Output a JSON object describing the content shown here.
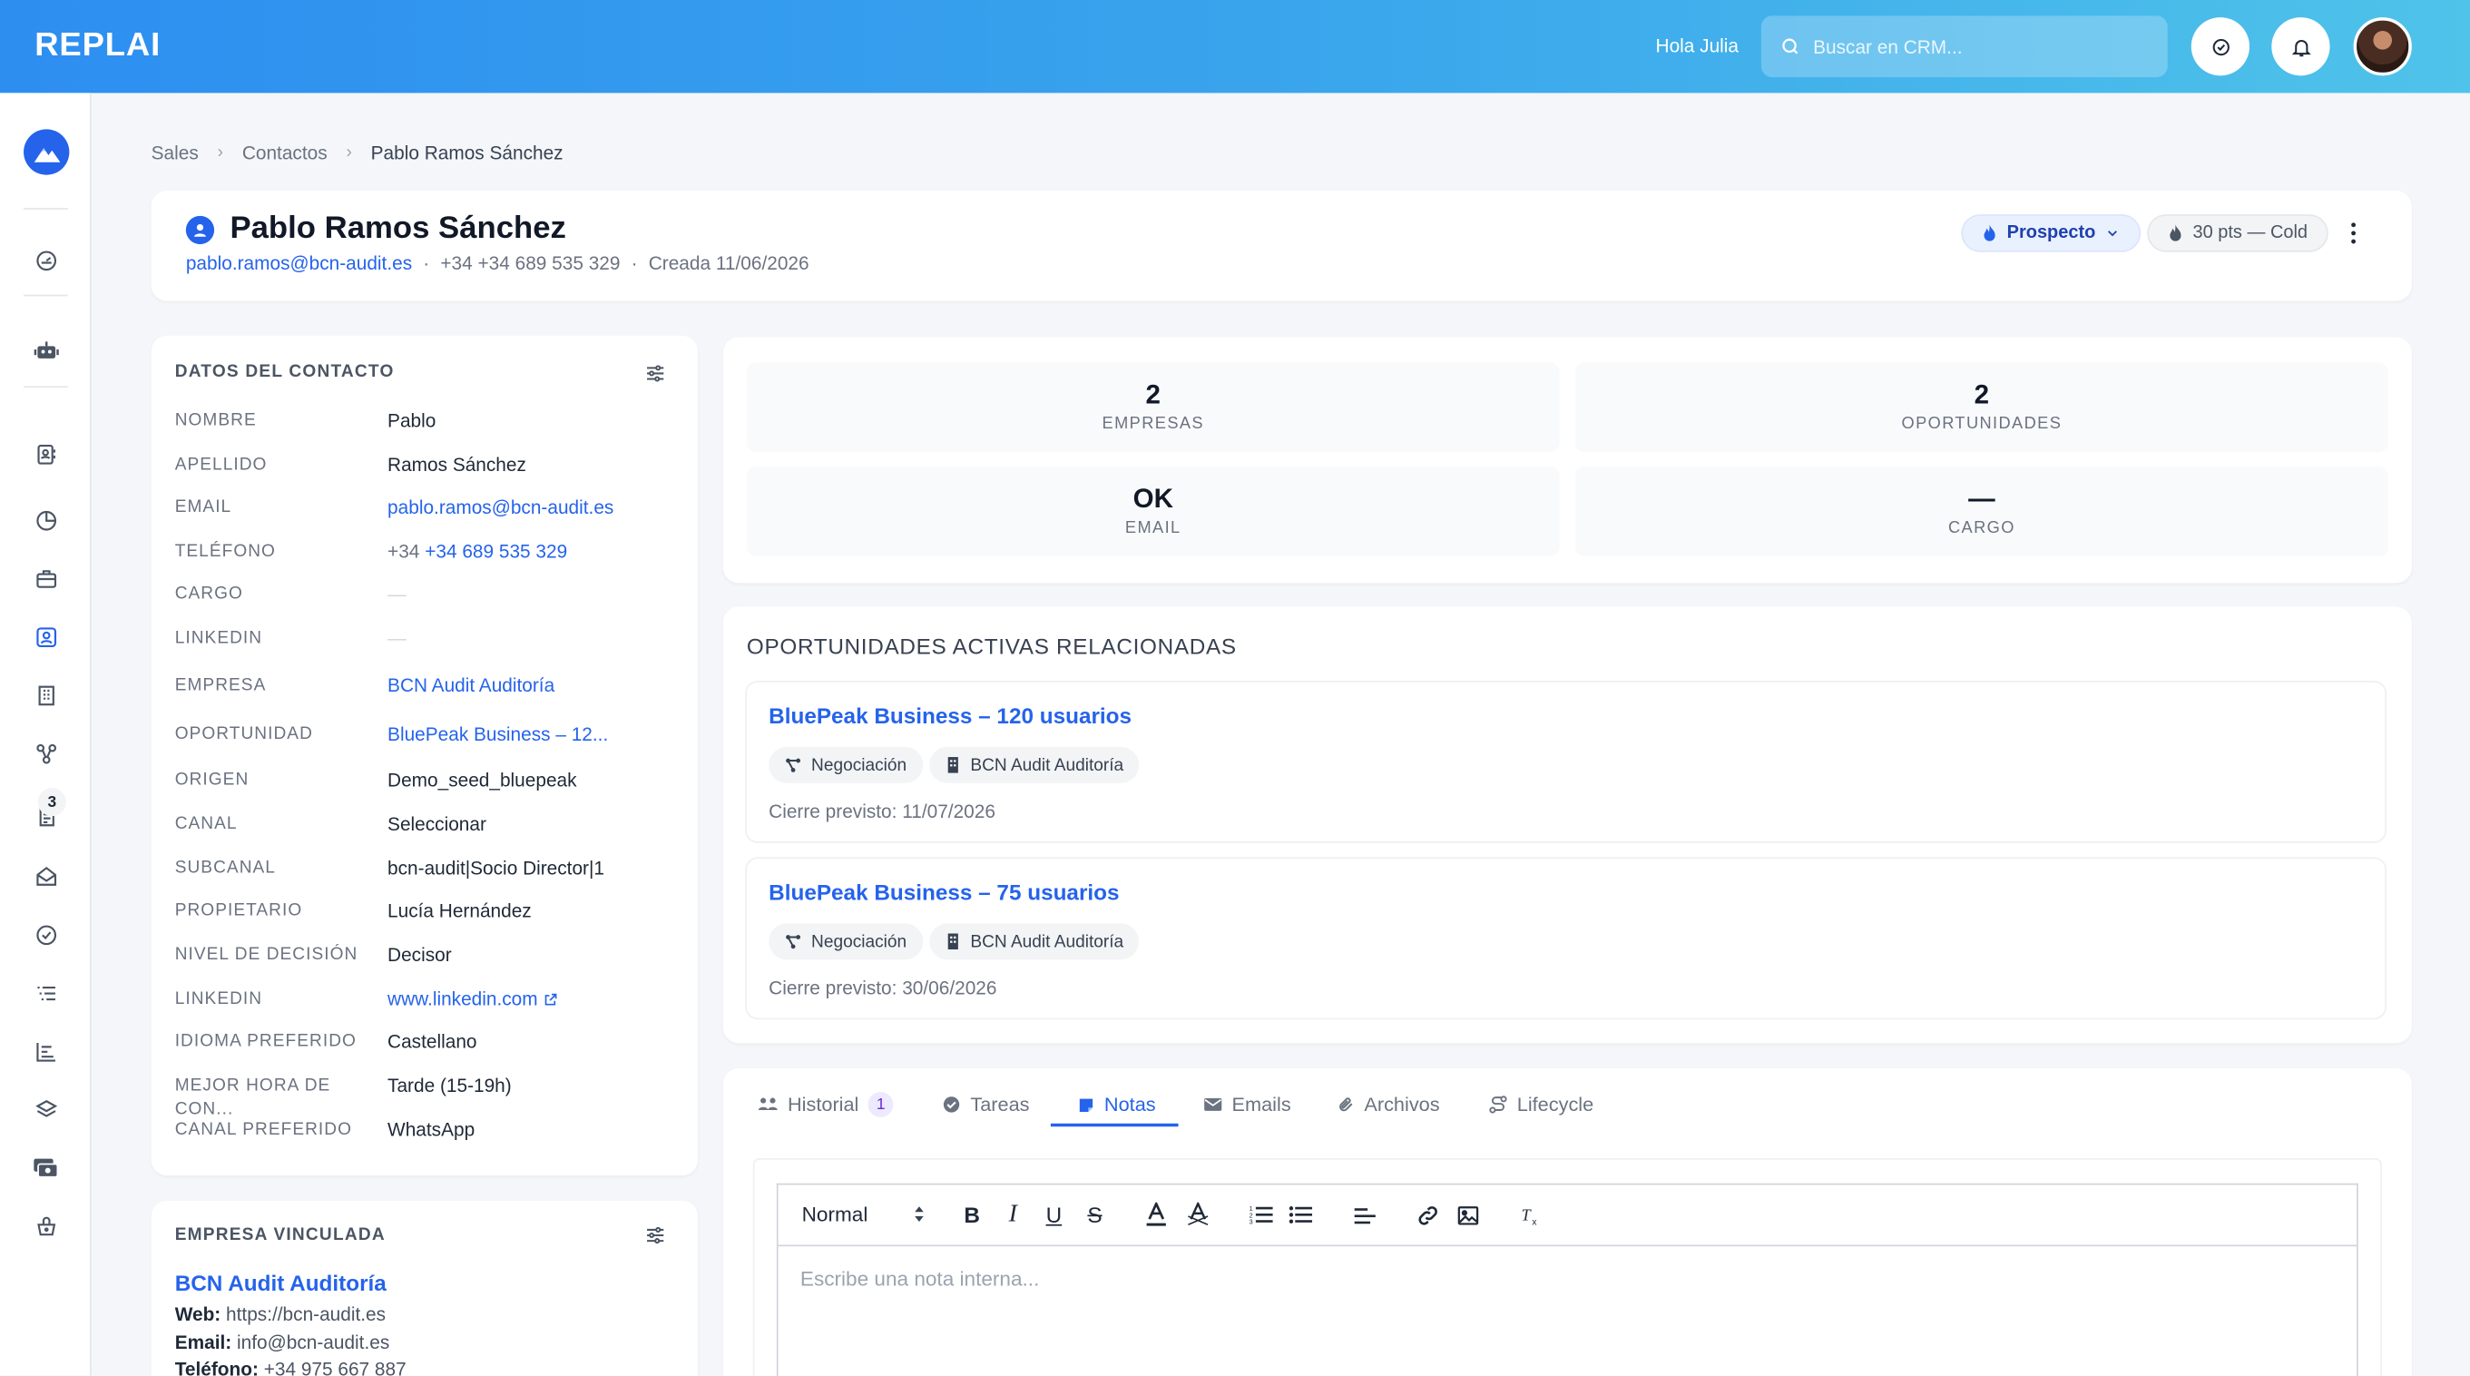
{
  "app": {
    "logo": "REPLAI",
    "greeting": "Hola Julia",
    "search_placeholder": "Buscar en CRM...",
    "accent": "#2563eb"
  },
  "sidebar": {
    "badge_count": "3",
    "items": [
      "brand-icon",
      "dashboard-icon",
      "robot-icon",
      "contact-card-icon",
      "chart-pie-icon",
      "briefcase-icon",
      "contacts-icon",
      "building-icon",
      "network-icon",
      "document-icon",
      "inbox-icon",
      "check-circle-icon",
      "list-icon",
      "bar-chart-icon",
      "layers-icon",
      "money-icon",
      "basket-icon"
    ],
    "active": "contacts-icon"
  },
  "breadcrumb": [
    "Sales",
    "Contactos",
    "Pablo Ramos Sánchez"
  ],
  "contact": {
    "name": "Pablo Ramos Sánchez",
    "email": "pablo.ramos@bcn-audit.es",
    "phone": "+34 +34 689 535 329",
    "created": "Creada 11/06/2026",
    "stage": "Prospecto",
    "score": "30 pts — Cold"
  },
  "details": {
    "title": "DATOS DEL CONTACTO",
    "fields": [
      {
        "label": "NOMBRE",
        "value": "Pablo"
      },
      {
        "label": "APELLIDO",
        "value": "Ramos Sánchez"
      },
      {
        "label": "EMAIL",
        "value": "pablo.ramos@bcn-audit.es"
      },
      {
        "label": "TELÉFONO",
        "prefix": "+34",
        "value": "+34 689 535 329"
      },
      {
        "label": "CARGO",
        "value": "—"
      },
      {
        "label": "LINKEDIN",
        "value": "—"
      },
      {
        "label": "EMPRESA",
        "value": "BCN Audit Auditoría"
      },
      {
        "label": "OPORTUNIDAD",
        "value": "BluePeak Business – 12..."
      },
      {
        "label": "ORIGEN",
        "value": "Demo_seed_bluepeak"
      },
      {
        "label": "CANAL",
        "value": "Seleccionar"
      },
      {
        "label": "SUBCANAL",
        "value": "bcn-audit|Socio Director|1"
      },
      {
        "label": "PROPIETARIO",
        "value": "Lucía Hernández"
      },
      {
        "label": "NIVEL DE DECISIÓN",
        "value": "Decisor"
      },
      {
        "label": "LINKEDIN",
        "value": "www.linkedin.com"
      },
      {
        "label": "IDIOMA PREFERIDO",
        "value": "Castellano"
      },
      {
        "label": "MEJOR HORA DE CON...",
        "value": "Tarde (15-19h)"
      },
      {
        "label": "CANAL PREFERIDO",
        "value": "WhatsApp"
      }
    ]
  },
  "company": {
    "title": "EMPRESA VINCULADA",
    "name": "BCN Audit Auditoría",
    "web_label": "Web:",
    "web": "https://bcn-audit.es",
    "email_label": "Email:",
    "email": "info@bcn-audit.es",
    "phone_label": "Teléfono:",
    "phone": "+34 975 667 887"
  },
  "stats": [
    {
      "value": "2",
      "label": "EMPRESAS"
    },
    {
      "value": "2",
      "label": "OPORTUNIDADES"
    },
    {
      "value": "OK",
      "label": "EMAIL"
    },
    {
      "value": "—",
      "label": "CARGO"
    }
  ],
  "opportunities": {
    "title": "OPORTUNIDADES ACTIVAS RELACIONADAS",
    "items": [
      {
        "name": "BluePeak Business – 120 usuarios",
        "stage": "Negociación",
        "company": "BCN Audit Auditoría",
        "close": "Cierre previsto: 11/07/2026"
      },
      {
        "name": "BluePeak Business – 75 usuarios",
        "stage": "Negociación",
        "company": "BCN Audit Auditoría",
        "close": "Cierre previsto: 30/06/2026"
      }
    ]
  },
  "tabs": {
    "items": [
      {
        "label": "Historial",
        "count": "1"
      },
      {
        "label": "Tareas"
      },
      {
        "label": "Notas"
      },
      {
        "label": "Emails"
      },
      {
        "label": "Archivos"
      },
      {
        "label": "Lifecycle"
      }
    ],
    "active": "Notas"
  },
  "editor": {
    "format": "Normal",
    "placeholder": "Escribe una nota interna..."
  }
}
